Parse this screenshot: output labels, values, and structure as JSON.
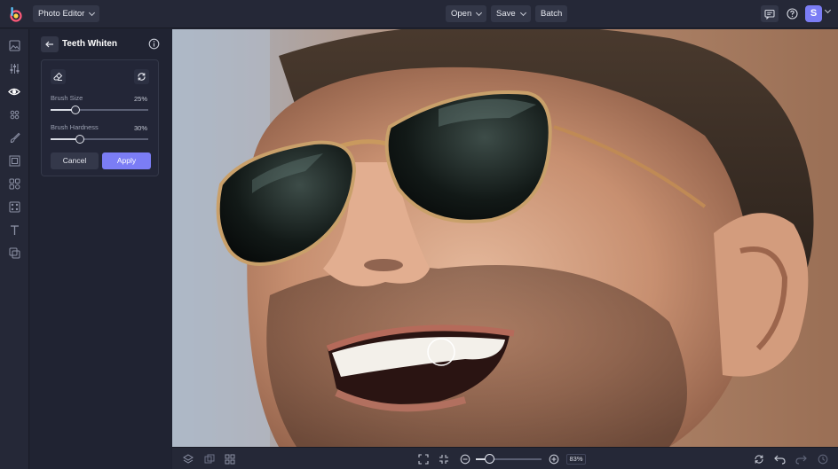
{
  "topbar": {
    "app_switch_label": "Photo Editor",
    "open_label": "Open",
    "save_label": "Save",
    "batch_label": "Batch",
    "avatar_initial": "S"
  },
  "rail": {
    "items": [
      "photo-icon",
      "adjust-icon",
      "eye-icon",
      "effects-icon",
      "brush-icon",
      "frame-icon",
      "elements-icon",
      "texture-icon",
      "text-icon",
      "layers-icon"
    ],
    "active_index": 2
  },
  "panel": {
    "title": "Teeth Whiten",
    "brush_size_label": "Brush Size",
    "brush_size_value": "25%",
    "brush_size": 0.25,
    "brush_hardness_label": "Brush Hardness",
    "brush_hardness_value": "30%",
    "brush_hardness": 0.3,
    "cancel_label": "Cancel",
    "apply_label": "Apply"
  },
  "bottombar": {
    "zoom_value": "83%",
    "zoom": 0.2
  },
  "colors": {
    "accent": "#7b7df5",
    "bg": "#1f2230",
    "bar": "#252837"
  }
}
